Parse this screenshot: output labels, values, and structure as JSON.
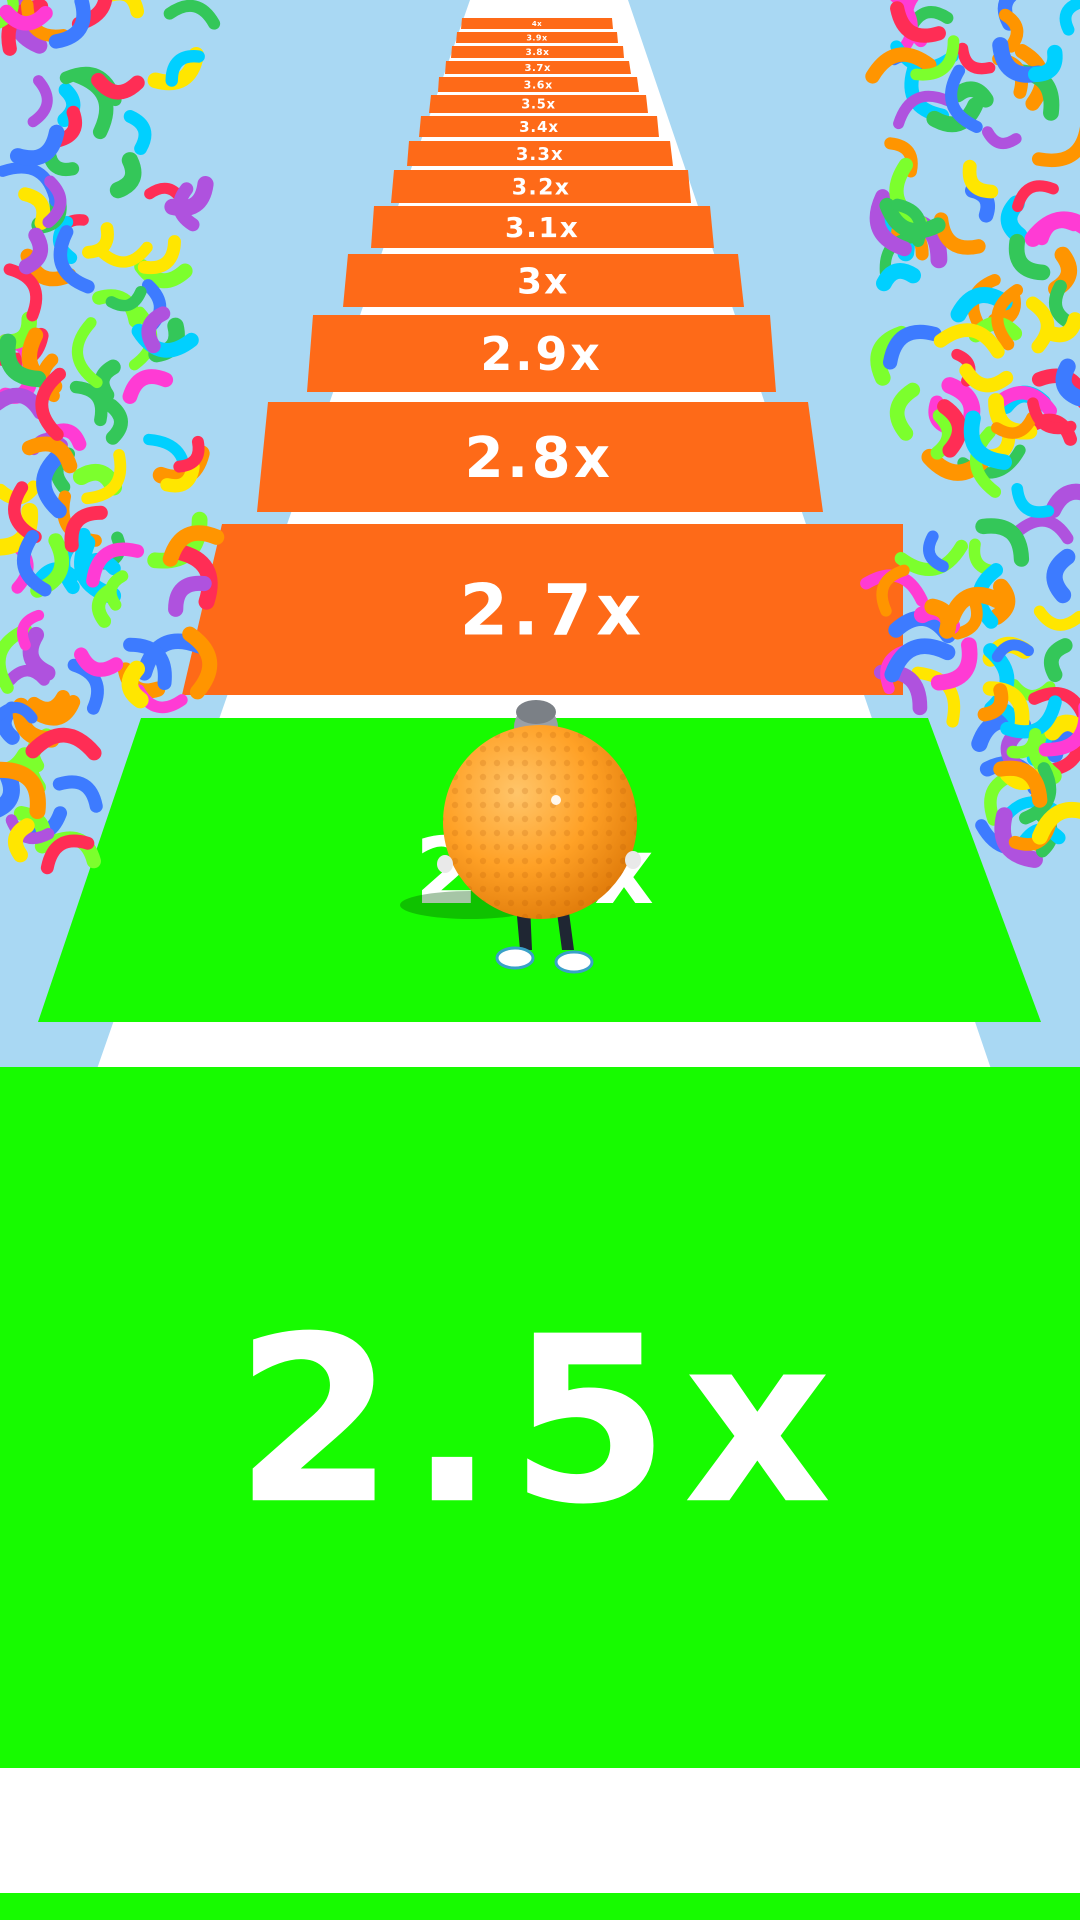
{
  "colors": {
    "sky": "#a9d8f3",
    "track_edge": "#ffffff",
    "tile_orange": "#fe6a18",
    "tile_green": "#17fb00",
    "label": "#ffffff",
    "ball": "#ffa126"
  },
  "tiles": [
    {
      "label": "2.5x",
      "color": "green"
    },
    {
      "label": "2.5x",
      "color": "green"
    },
    {
      "label": "2.7x",
      "color": "orange"
    },
    {
      "label": "2.8x",
      "color": "orange"
    },
    {
      "label": "2.9x",
      "color": "orange"
    },
    {
      "label": "3x",
      "color": "orange"
    },
    {
      "label": "3.1x",
      "color": "orange"
    },
    {
      "label": "3.2x",
      "color": "orange"
    },
    {
      "label": "3.3x",
      "color": "orange"
    },
    {
      "label": "3.4x",
      "color": "orange"
    },
    {
      "label": "3.5x",
      "color": "orange"
    },
    {
      "label": "3.6x",
      "color": "orange"
    },
    {
      "label": "3.7x",
      "color": "orange"
    },
    {
      "label": "3.8x",
      "color": "orange"
    },
    {
      "label": "3.9x",
      "color": "orange"
    },
    {
      "label": "4x",
      "color": "orange"
    }
  ],
  "player": {
    "name": "player-character",
    "item": "golf-ball-suit"
  },
  "confetti_colors": [
    "#ff2d55",
    "#ff9500",
    "#ffe600",
    "#34c759",
    "#00d0ff",
    "#af52de",
    "#ff3bd4",
    "#3d7bff",
    "#7cff2d"
  ]
}
